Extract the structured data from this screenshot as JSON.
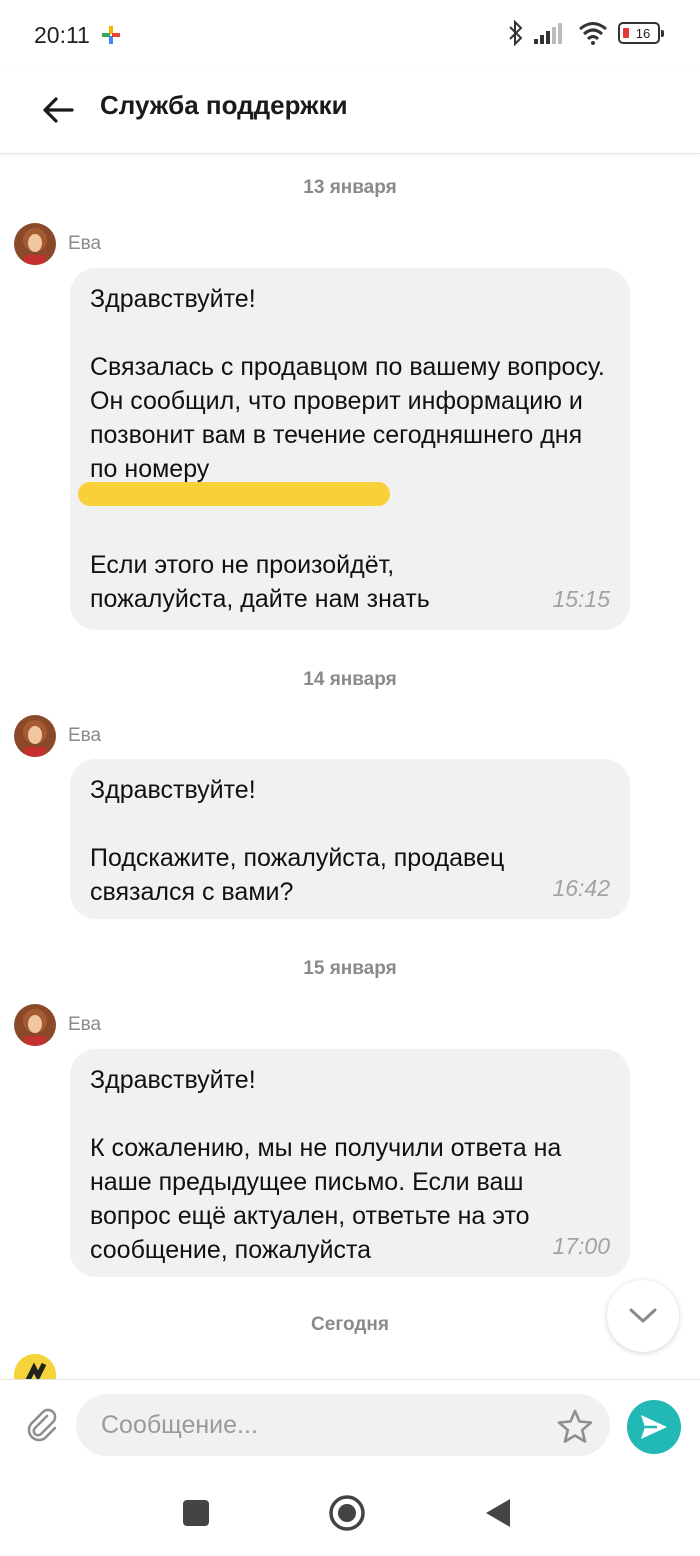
{
  "status_bar": {
    "time": "20:11",
    "battery": "16"
  },
  "header": {
    "title": "Служба поддержки"
  },
  "colors": {
    "bubble_bg": "#f1f1f1",
    "send_button": "#22b8b5",
    "redaction": "#f9cf3a"
  },
  "chat": {
    "groups": [
      {
        "date": "13 января",
        "sender": "Ева",
        "greeting": "Здравствуйте!",
        "body": "Связалась с продавцом по вашему вопросу. Он сообщил, что проверит информацию и позвонит вам в течение сегодняшнего дня по номеру",
        "body2": "Если этого не произойдёт, пожалуйста, дайте нам знать",
        "time": "15:15"
      },
      {
        "date": "14 января",
        "sender": "Ева",
        "greeting": "Здравствуйте!",
        "body": "Подскажите, пожалуйста, продавец связался с вами?",
        "time": "16:42"
      },
      {
        "date": "15 января",
        "sender": "Ева",
        "greeting": "Здравствуйте!",
        "body": "К сожалению, мы не получили ответа на наше предыдущее письмо. Если ваш вопрос ещё актуален, ответьте на это сообщение, пожалуйста",
        "time": "17:00"
      }
    ],
    "today_label": "Сегодня"
  },
  "composer": {
    "placeholder": "Сообщение..."
  },
  "icons": {
    "back": "arrow-left-icon",
    "attach": "paperclip-icon",
    "star": "star-icon",
    "send": "send-icon",
    "scroll": "chevron-down-icon"
  }
}
